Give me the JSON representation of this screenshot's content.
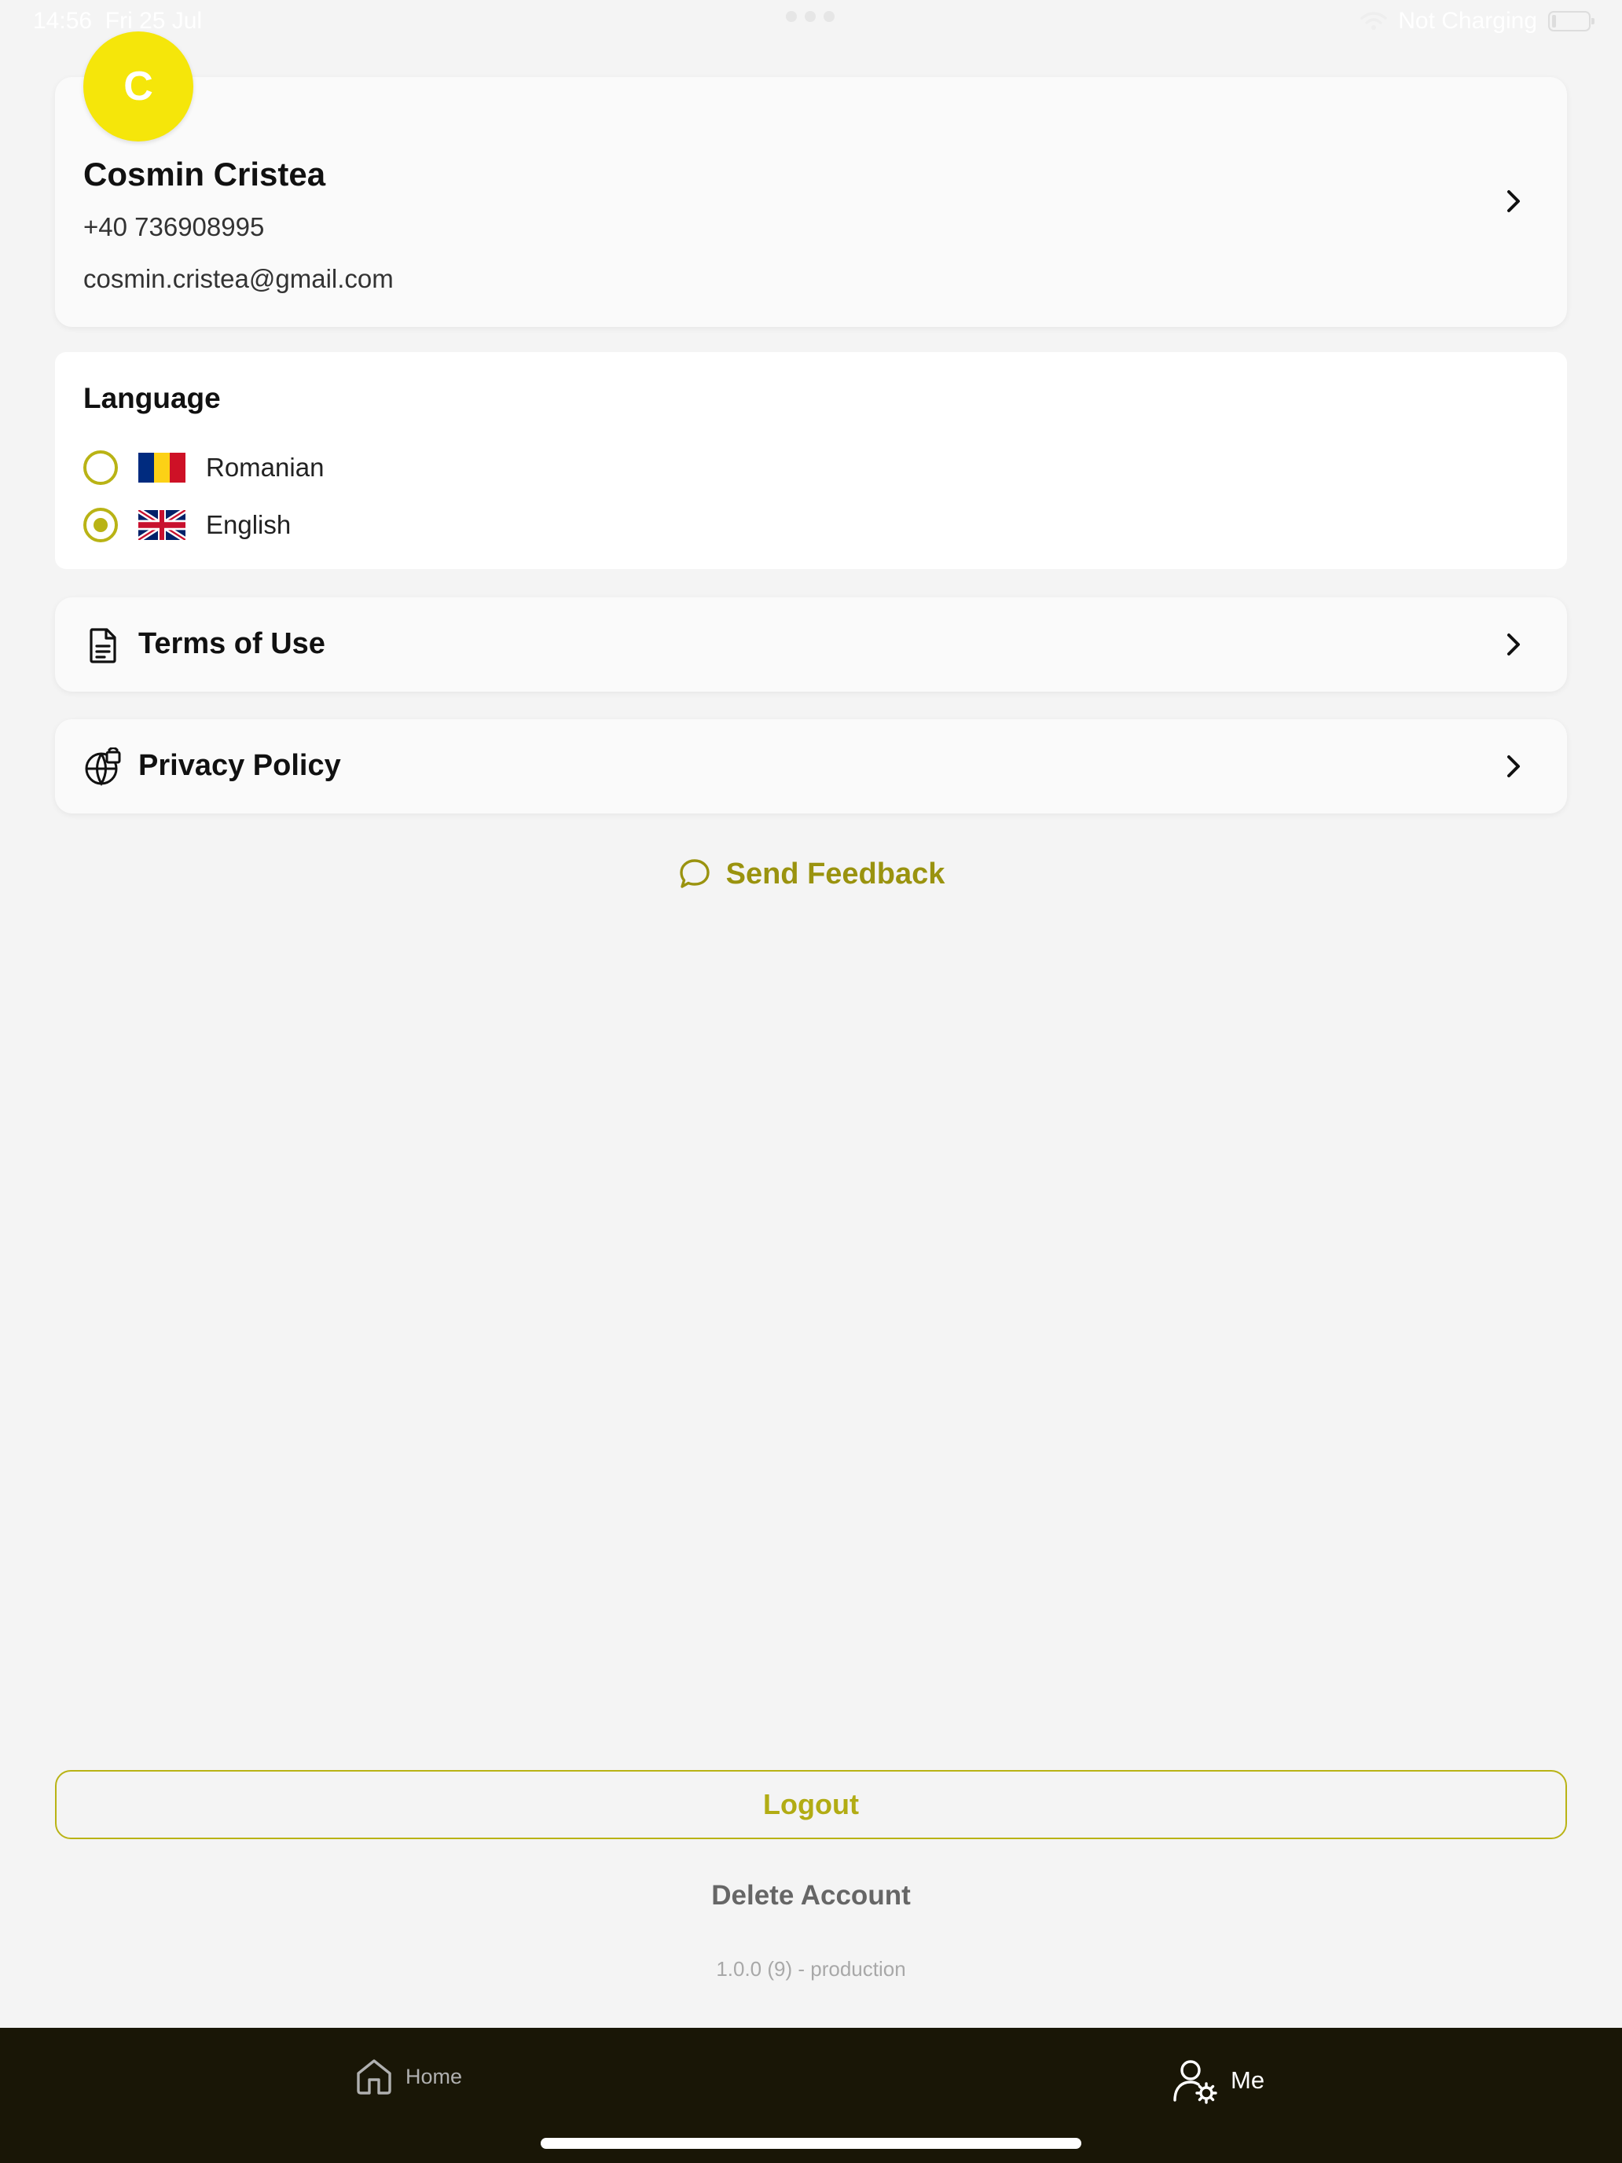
{
  "status_bar": {
    "time": "14:56",
    "date": "Fri 25 Jul",
    "charging": "Not Charging"
  },
  "profile": {
    "initial": "C",
    "name": "Cosmin Cristea",
    "phone": "+40 736908995",
    "email": "cosmin.cristea@gmail.com"
  },
  "language": {
    "title": "Language",
    "options": [
      {
        "label": "Romanian",
        "selected": false
      },
      {
        "label": "English",
        "selected": true
      }
    ]
  },
  "links": {
    "terms": "Terms of Use",
    "privacy": "Privacy Policy"
  },
  "feedback": {
    "label": "Send Feedback"
  },
  "actions": {
    "logout": "Logout",
    "delete_account": "Delete Account"
  },
  "version": "1.0.0 (9) - production",
  "tabs": {
    "home": "Home",
    "me": "Me"
  },
  "colors": {
    "accent": "#b9b315",
    "avatar": "#f5e60a",
    "tab_bar": "#191606",
    "background": "#f4f4f4"
  }
}
